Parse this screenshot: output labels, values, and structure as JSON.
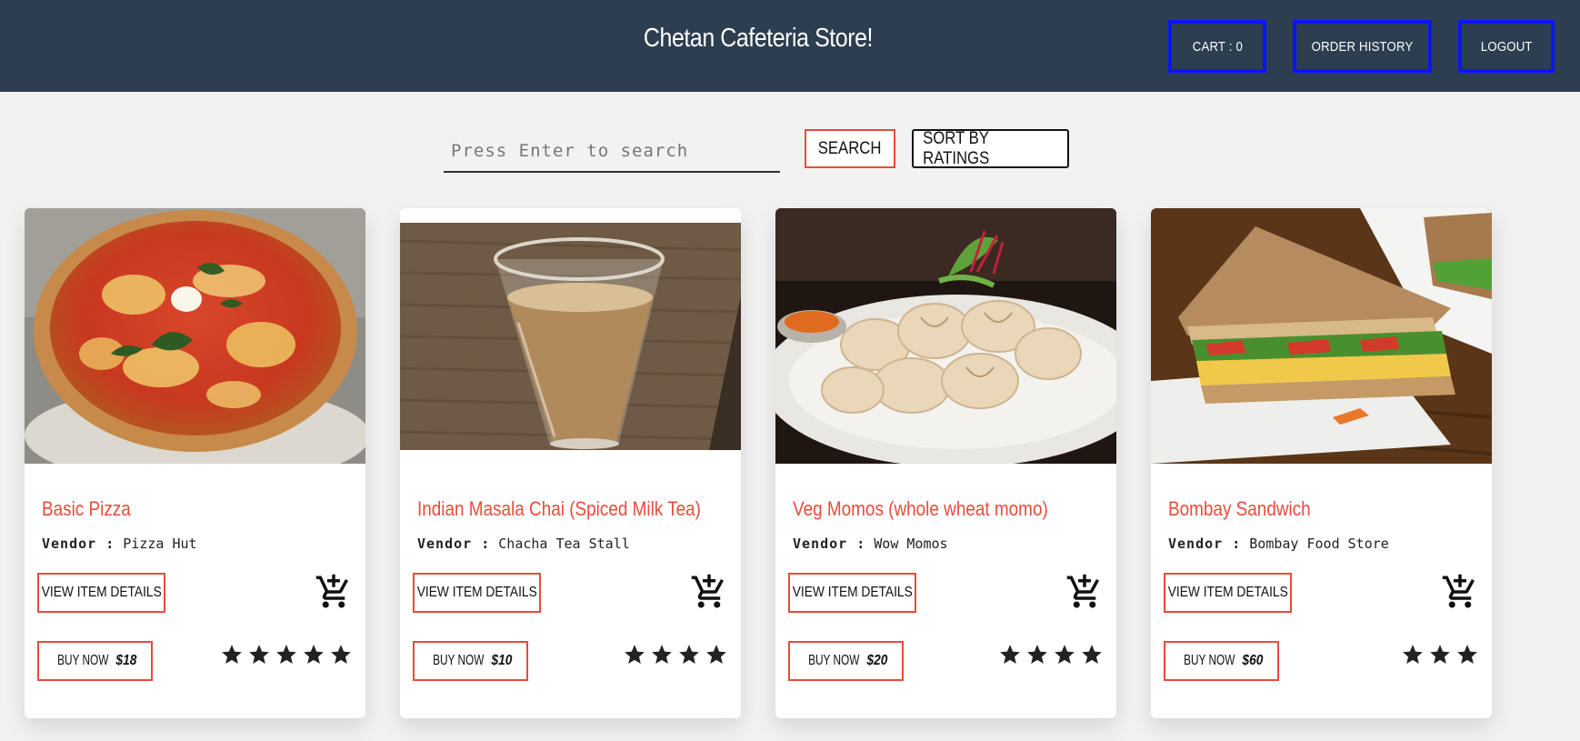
{
  "header": {
    "title": "Chetan Cafeteria Store!",
    "cart_label": "CART : 0",
    "order_history_label": "ORDER HISTORY",
    "logout_label": "LOGOUT"
  },
  "search": {
    "placeholder": "Press Enter to search",
    "search_label": "SEARCH",
    "sort_label": "SORT BY RATINGS"
  },
  "items": [
    {
      "name": "Basic Pizza",
      "vendor_label": "Vendor :",
      "vendor": "Pizza Hut",
      "view_label": "VIEW ITEM DETAILS",
      "buy_label": "BUY NOW",
      "price": "$18",
      "rating": 5,
      "image": "pizza"
    },
    {
      "name": "Indian Masala Chai (Spiced Milk Tea)",
      "vendor_label": "Vendor :",
      "vendor": "Chacha Tea Stall",
      "view_label": "VIEW ITEM DETAILS",
      "buy_label": "BUY NOW",
      "price": "$10",
      "rating": 4,
      "image": "chai"
    },
    {
      "name": "Veg Momos (whole wheat momo)",
      "vendor_label": "Vendor :",
      "vendor": "Wow Momos",
      "view_label": "VIEW ITEM DETAILS",
      "buy_label": "BUY NOW",
      "price": "$20",
      "rating": 4,
      "image": "momos"
    },
    {
      "name": "Bombay Sandwich",
      "vendor_label": "Vendor :",
      "vendor": "Bombay Food Store",
      "view_label": "VIEW ITEM DETAILS",
      "buy_label": "BUY NOW",
      "price": "$60",
      "rating": 3,
      "image": "sandwich"
    }
  ],
  "colors": {
    "header_bg": "#2c3e50",
    "accent": "#e74c3c",
    "nav_border": "#0a14ff"
  }
}
